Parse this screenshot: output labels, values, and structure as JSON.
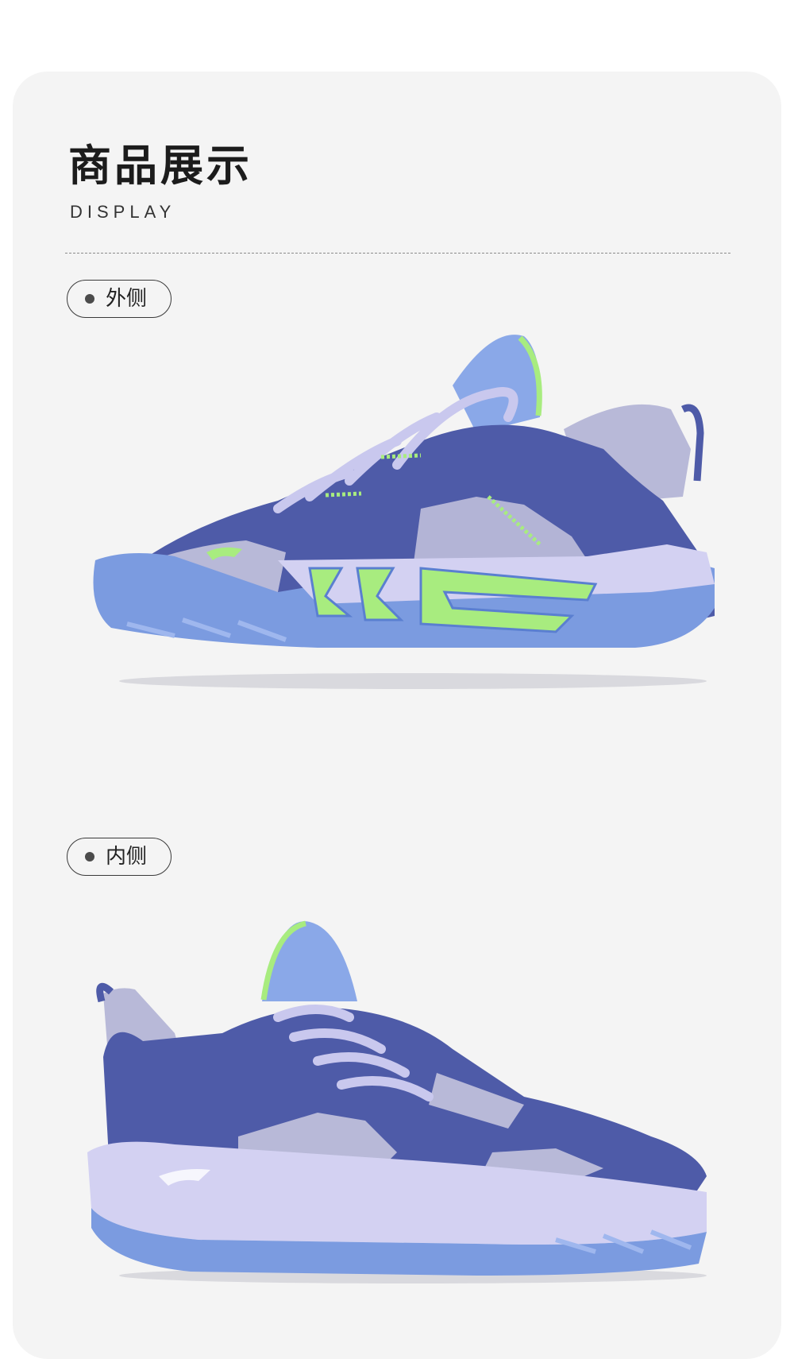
{
  "section": {
    "title": "商品展示",
    "subtitle": "DISPLAY"
  },
  "views": [
    {
      "label": "外侧",
      "image": "shoe-lateral-view"
    },
    {
      "label": "内侧",
      "image": "shoe-medial-view"
    }
  ],
  "colors": {
    "background": "#f4f4f4",
    "upper_navy": "#4e5ba8",
    "mesh_lavender": "#b8b9d8",
    "outsole_blue": "#7b9be0",
    "accent_green": "#a8ec7f",
    "midsole_lilac": "#d3d1f2"
  }
}
